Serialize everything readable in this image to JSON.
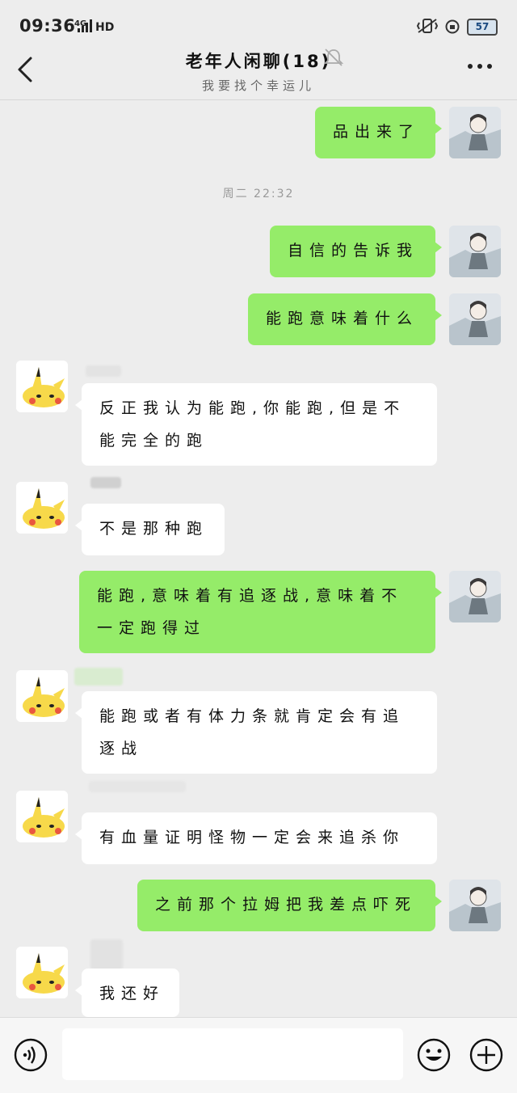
{
  "status_bar": {
    "time": "09:36",
    "network": "4G",
    "signal_label": "HD",
    "battery": "57"
  },
  "header": {
    "title": "老年人闲聊(18)",
    "subtitle": "我要找个幸运儿"
  },
  "timestamp": "周二 22:32",
  "messages": [
    {
      "from": "me",
      "text": "品出来了"
    },
    {
      "from": "me",
      "text": "自信的告诉我"
    },
    {
      "from": "me",
      "text": "能跑意味着什么"
    },
    {
      "from": "them",
      "text": "反正我认为能跑,你能跑,但是不能完全的跑"
    },
    {
      "from": "them",
      "text": "不是那种跑"
    },
    {
      "from": "me",
      "text": "能跑,意味着有追逐战,意味着不一定跑得过"
    },
    {
      "from": "them",
      "text": "能跑或者有体力条就肯定会有追逐战"
    },
    {
      "from": "them",
      "text": "有血量证明怪物一定会来追杀你"
    },
    {
      "from": "me",
      "text": "之前那个拉姆把我差点吓死"
    },
    {
      "from": "them",
      "text": "我还好"
    }
  ],
  "colors": {
    "my_bubble": "#95ec69",
    "their_bubble": "#ffffff",
    "background": "#ededed"
  },
  "icons": [
    "back-arrow-icon",
    "mute-bell-icon",
    "more-dots-icon",
    "voice-icon",
    "emoji-icon",
    "plus-icon",
    "avatar-anime",
    "avatar-pikachu"
  ]
}
